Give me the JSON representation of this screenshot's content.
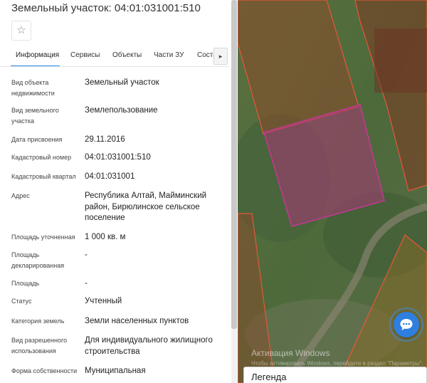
{
  "panel": {
    "title": "Земельный участок: 04:01:031001:510",
    "favorite_icon": "star-icon",
    "tabs": [
      {
        "label": "Информация",
        "active": true
      },
      {
        "label": "Сервисы",
        "active": false
      },
      {
        "label": "Объекты",
        "active": false
      },
      {
        "label": "Части ЗУ",
        "active": false
      },
      {
        "label": "Состав",
        "active": false
      }
    ],
    "tab_scroll_icon": "chevron-right-icon",
    "tab_scroll_glyph": "▸",
    "accent_color": "#2d8cf0",
    "fields": [
      {
        "label": "Вид объекта недвижимости",
        "value": "Земельный участок"
      },
      {
        "label": "Вид земельного участка",
        "value": "Землепользование"
      },
      {
        "label": "Дата присвоения",
        "value": "29.11.2016"
      },
      {
        "label": "Кадастровый номер",
        "value": "04:01:031001:510"
      },
      {
        "label": "Кадастровый квартал",
        "value": "04:01:031001"
      },
      {
        "label": "Адрес",
        "value": "Республика Алтай, Майминский район, Бирюлинское сельское поселение"
      },
      {
        "label": "Площадь уточненная",
        "value": "1 000 кв. м"
      },
      {
        "label": "Площадь декларированная",
        "value": "-"
      },
      {
        "label": "Площадь",
        "value": "-"
      },
      {
        "label": "Статус",
        "value": "Учтенный"
      },
      {
        "label": "Категория земель",
        "value": "Земли населенных пунктов"
      },
      {
        "label": "Вид разрешенного использования",
        "value": "Для индивидуального жилищного строительства"
      },
      {
        "label": "Форма собственности",
        "value": "Муниципальная"
      }
    ]
  },
  "map": {
    "watermark_title": "Активация Windows",
    "watermark_subtitle": "Чтобы активировать Windows, перейдите в раздел \"Параметры\".",
    "legend_label": "Легенда",
    "chat_icon": "chat-bubble-icon",
    "parcel_border_color": "#e8553a",
    "selected_parcel_color": "#c0398f"
  }
}
